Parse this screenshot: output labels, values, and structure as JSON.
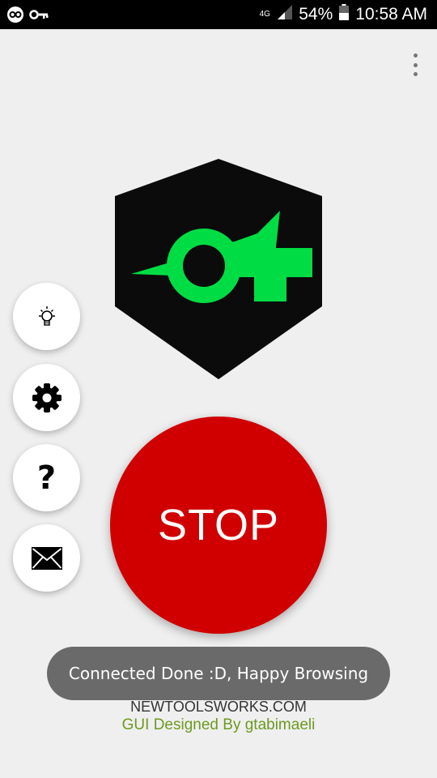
{
  "status_bar": {
    "network_type": "4G",
    "battery": "54%",
    "time": "10:58 AM"
  },
  "icons": {
    "notification_1": "infinity-key-icon",
    "notification_2": "key-icon",
    "signal": "signal-icon",
    "battery": "battery-icon",
    "menu": "more-vert-icon",
    "tips": "lightbulb-icon",
    "settings": "gear-icon",
    "help": "help-icon",
    "contact": "mail-icon"
  },
  "colors": {
    "stop_button": "#d10000",
    "logo_accent": "#00dd44",
    "toast_bg": "#6a6a6a",
    "credit_text": "#6c9a1f"
  },
  "help_button": {
    "label": "?"
  },
  "stop_button": {
    "label": "STOP"
  },
  "toast": {
    "message": "Connected Done :D, Happy Browsing"
  },
  "footer": {
    "site": "NEWTOOLSWORKS.COM",
    "credit": "GUI  Designed By gtabimaeli"
  }
}
